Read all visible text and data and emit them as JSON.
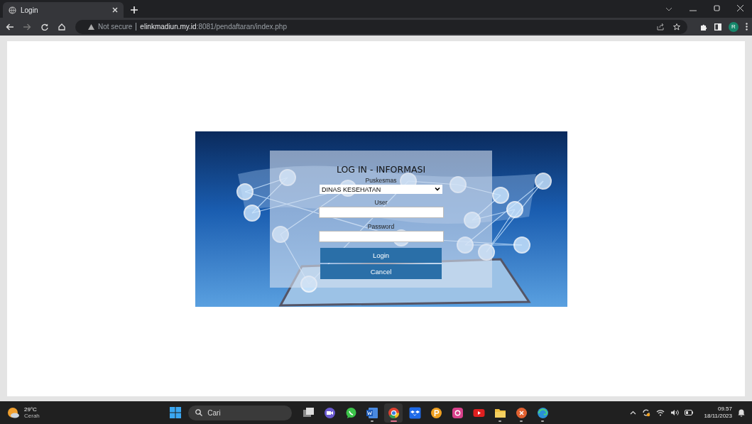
{
  "browser": {
    "tab": {
      "title": "Login"
    },
    "address": {
      "security": "Not secure",
      "host": "elinkmadiun.my.id",
      "path": ":8081/pendaftaran/index.php"
    },
    "profile": "R"
  },
  "login_form": {
    "title": "LOG IN - INFORMASI",
    "fields": [
      {
        "label": "Puskesmas",
        "kind": "select",
        "value": "DINAS KESEHATAN"
      },
      {
        "label": "User",
        "kind": "text"
      },
      {
        "label": "Password",
        "kind": "password"
      }
    ],
    "buttons": [
      "Login",
      "Cancel"
    ]
  },
  "taskbar": {
    "weather": {
      "temperature": "29°C",
      "condition": "Cerah"
    },
    "search": {
      "placeholder": "Cari"
    },
    "apps": [
      {
        "kind": "taskview",
        "running": false,
        "selected": false
      },
      {
        "kind": "meet",
        "running": false,
        "selected": false
      },
      {
        "kind": "whatsapp",
        "running": false,
        "selected": false
      },
      {
        "kind": "word",
        "running": true,
        "selected": false
      },
      {
        "kind": "chrome",
        "running": true,
        "selected": true
      },
      {
        "kind": "dropbox",
        "running": false,
        "selected": false
      },
      {
        "kind": "pcircle",
        "running": false,
        "selected": false
      },
      {
        "kind": "instagram",
        "running": false,
        "selected": false
      },
      {
        "kind": "youtube",
        "running": false,
        "selected": false
      },
      {
        "kind": "folder",
        "running": true,
        "selected": false
      },
      {
        "kind": "xapp",
        "running": true,
        "selected": false
      },
      {
        "kind": "edge",
        "running": true,
        "selected": false
      }
    ],
    "clock": {
      "time": "09.57",
      "date": "18/11/2023"
    }
  }
}
